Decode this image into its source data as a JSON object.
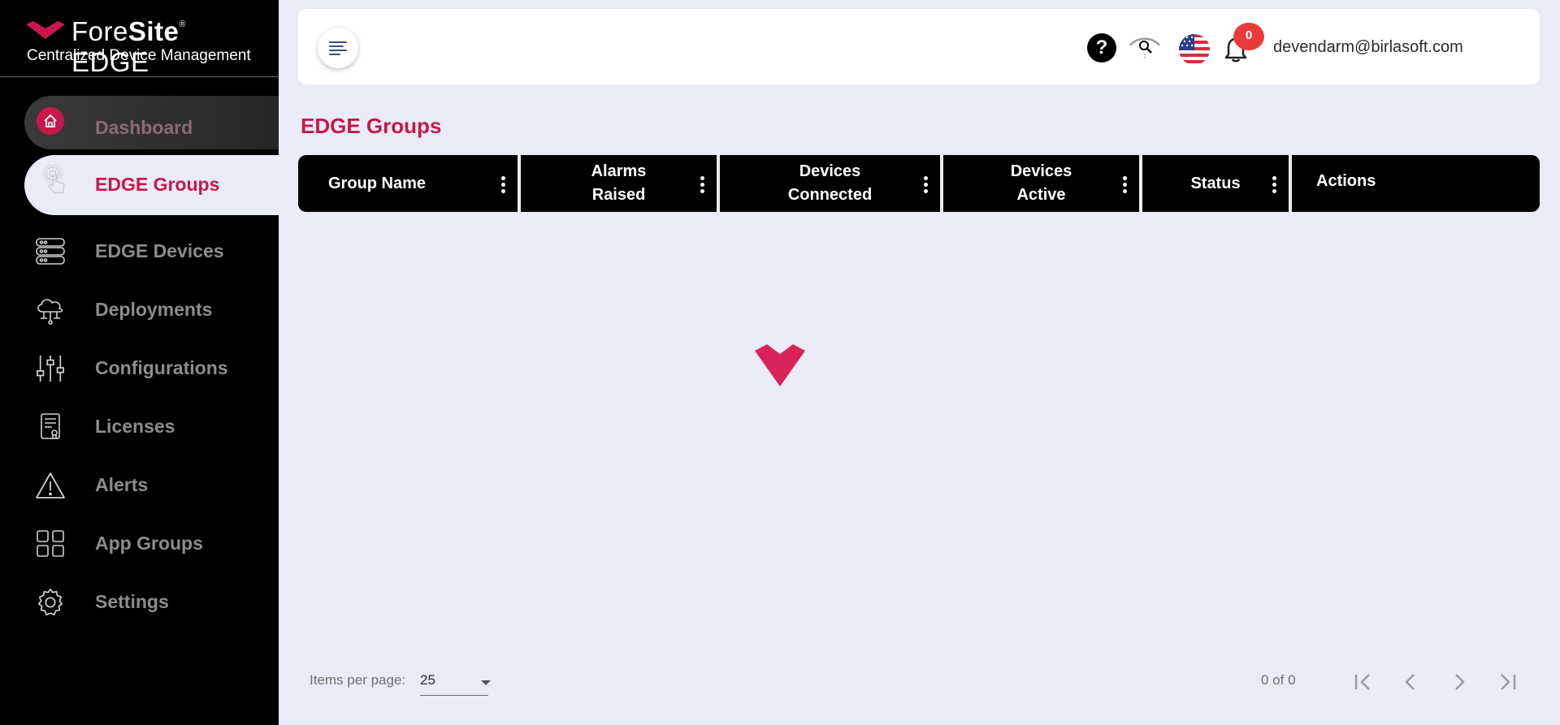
{
  "brand": {
    "name_light": "Fore",
    "name_bold": "Site",
    "reg_mark": "®",
    "name_suffix": "EDGE",
    "subtitle": "Centralized Device Management",
    "accent": "#c8174a"
  },
  "sidebar": {
    "items": [
      {
        "label": "Dashboard",
        "icon": "home-icon"
      },
      {
        "label": "EDGE Groups",
        "icon": "touch-icon",
        "active": true
      },
      {
        "label": "EDGE Devices",
        "icon": "server-icon"
      },
      {
        "label": "Deployments",
        "icon": "cloud-network-icon"
      },
      {
        "label": "Configurations",
        "icon": "sliders-icon"
      },
      {
        "label": "Licenses",
        "icon": "certificate-icon"
      },
      {
        "label": "Alerts",
        "icon": "warning-icon"
      },
      {
        "label": "App Groups",
        "icon": "grid-icon"
      },
      {
        "label": "Settings",
        "icon": "gear-icon"
      }
    ]
  },
  "header": {
    "help_glyph": "?",
    "notification_count": "0",
    "user_email": "devendarm@birlasoft.com"
  },
  "main": {
    "title": "EDGE Groups",
    "columns": [
      {
        "label": "Group Name"
      },
      {
        "label": "Alarms Raised"
      },
      {
        "label": "Devices Connected"
      },
      {
        "label": "Devices Active"
      },
      {
        "label": "Status"
      },
      {
        "label": "Actions"
      }
    ]
  },
  "pagination": {
    "items_per_page_label": "Items per page:",
    "items_per_page_value": "25",
    "range_label": "0 of 0"
  }
}
